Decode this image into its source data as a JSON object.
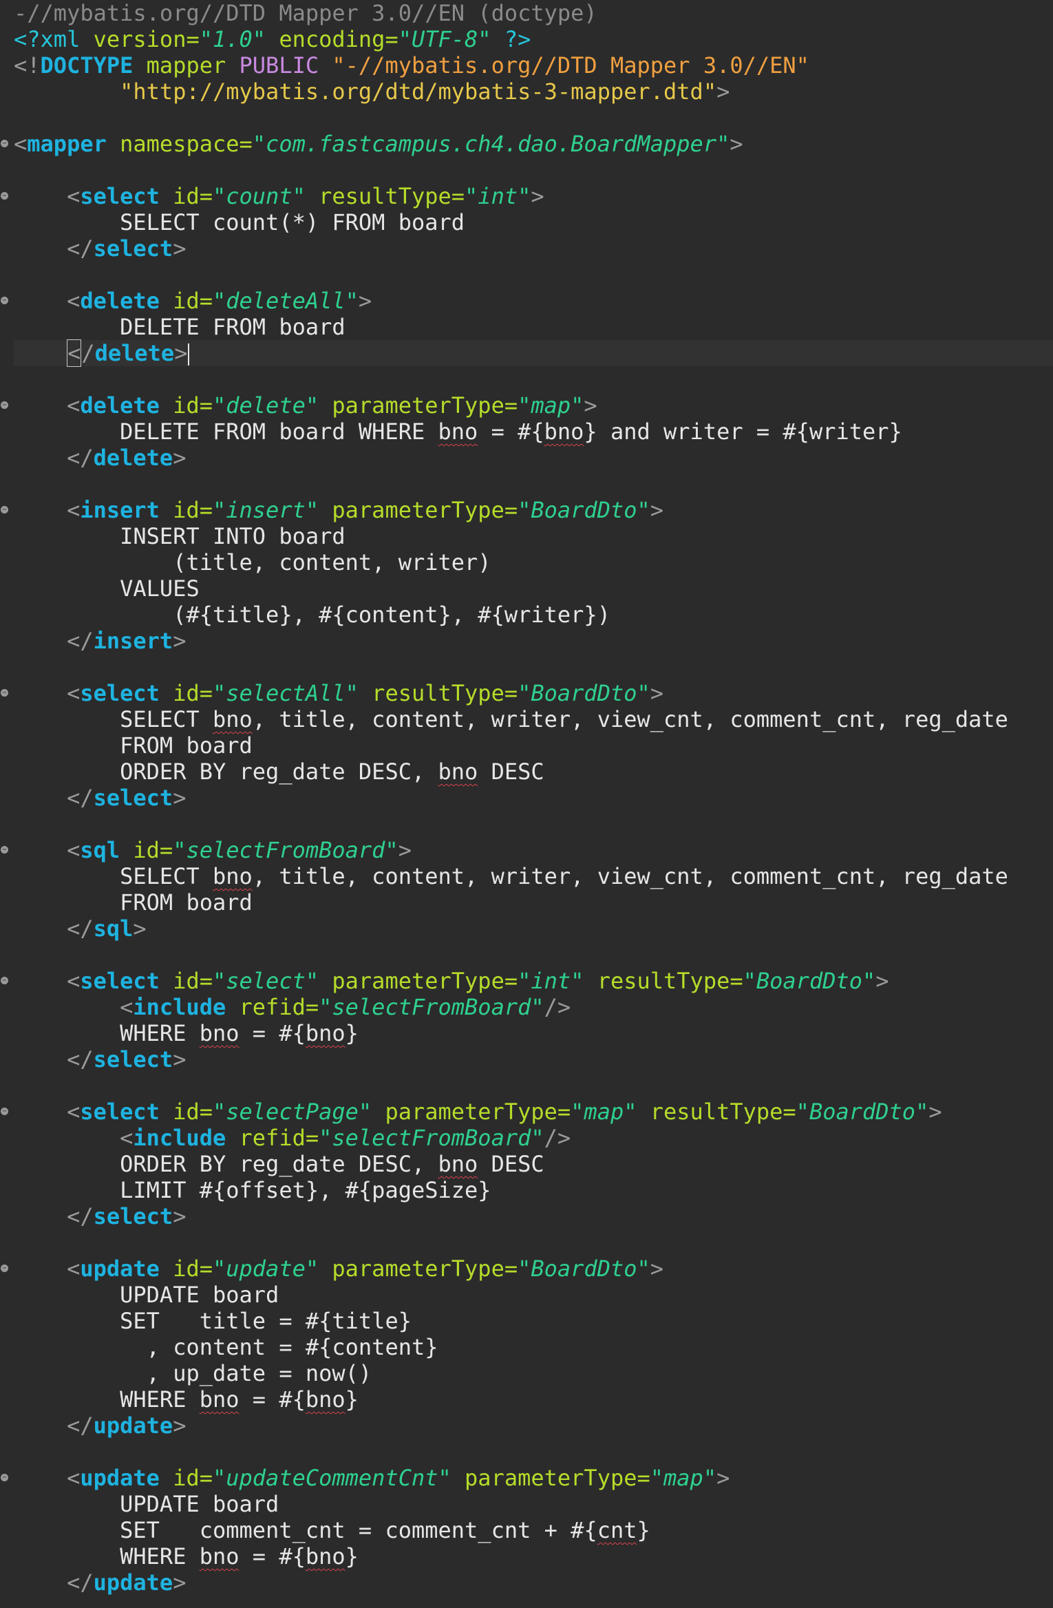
{
  "editor": {
    "lines": [
      [
        {
          "c": "c-comment",
          "t": "-//mybatis.org//DTD Mapper 3.0//EN (doctype)"
        }
      ],
      [
        {
          "c": "c-pi",
          "t": "<?xml "
        },
        {
          "c": "c-attr",
          "t": "version="
        },
        {
          "c": "c-val",
          "t": "\"1.0\""
        },
        {
          "c": "c-attr",
          "t": " encoding="
        },
        {
          "c": "c-val",
          "t": "\"UTF-8\""
        },
        {
          "c": "c-pi",
          "t": " ?>"
        }
      ],
      [
        {
          "c": "c-punct",
          "t": "<!"
        },
        {
          "c": "c-tag",
          "t": "DOCTYPE "
        },
        {
          "c": "c-attr",
          "t": "mapper "
        },
        {
          "c": "c-kw",
          "t": "PUBLIC "
        },
        {
          "c": "c-dstr",
          "t": "\"-//mybatis.org//DTD Mapper 3.0//EN\""
        }
      ],
      [
        {
          "c": "c-text",
          "t": "        "
        },
        {
          "c": "c-sstr",
          "t": "\"http://mybatis.org/dtd/mybatis-3-mapper.dtd\""
        },
        {
          "c": "c-punct",
          "t": ">"
        }
      ],
      [],
      [
        {
          "c": "c-punct",
          "t": "<"
        },
        {
          "c": "c-tag",
          "t": "mapper"
        },
        {
          "c": "c-attr",
          "t": " namespace="
        },
        {
          "c": "c-val",
          "t": "\"com.fastcampus.ch4.dao.BoardMapper\""
        },
        {
          "c": "c-punct",
          "t": ">"
        }
      ],
      [],
      [
        {
          "c": "c-text",
          "t": "    "
        },
        {
          "c": "c-punct",
          "t": "<"
        },
        {
          "c": "c-tag",
          "t": "select"
        },
        {
          "c": "c-attr",
          "t": " id="
        },
        {
          "c": "c-val",
          "t": "\"count\""
        },
        {
          "c": "c-attr",
          "t": " resultType="
        },
        {
          "c": "c-val",
          "t": "\"int\""
        },
        {
          "c": "c-punct",
          "t": ">"
        }
      ],
      [
        {
          "c": "c-text",
          "t": "        SELECT count(*) FROM board"
        }
      ],
      [
        {
          "c": "c-text",
          "t": "    "
        },
        {
          "c": "c-punct",
          "t": "</"
        },
        {
          "c": "c-tag",
          "t": "select"
        },
        {
          "c": "c-punct",
          "t": ">"
        }
      ],
      [],
      [
        {
          "c": "c-text",
          "t": "    "
        },
        {
          "c": "c-punct",
          "t": "<"
        },
        {
          "c": "c-tag",
          "t": "delete"
        },
        {
          "c": "c-attr",
          "t": " id="
        },
        {
          "c": "c-val",
          "t": "\"deleteAll\""
        },
        {
          "c": "c-punct",
          "t": ">"
        }
      ],
      [
        {
          "c": "c-text",
          "t": "        DELETE FROM board"
        }
      ],
      [
        {
          "c": "c-text",
          "t": "    "
        },
        {
          "c": "c-punct cur-box",
          "t": "<"
        },
        {
          "c": "c-punct",
          "t": "/"
        },
        {
          "c": "c-tag",
          "t": "delete"
        },
        {
          "c": "c-punct",
          "t": ">"
        }
      ],
      [],
      [
        {
          "c": "c-text",
          "t": "    "
        },
        {
          "c": "c-punct",
          "t": "<"
        },
        {
          "c": "c-tag",
          "t": "delete"
        },
        {
          "c": "c-attr",
          "t": " id="
        },
        {
          "c": "c-val",
          "t": "\"delete\""
        },
        {
          "c": "c-attr",
          "t": " parameterType="
        },
        {
          "c": "c-val",
          "t": "\"map\""
        },
        {
          "c": "c-punct",
          "t": ">"
        }
      ],
      [
        {
          "c": "c-text",
          "t": "        DELETE FROM board WHERE "
        },
        {
          "c": "c-text sq",
          "t": "bno"
        },
        {
          "c": "c-text",
          "t": " = #{"
        },
        {
          "c": "c-text sq",
          "t": "bno"
        },
        {
          "c": "c-text",
          "t": "} and writer = #{writer}"
        }
      ],
      [
        {
          "c": "c-text",
          "t": "    "
        },
        {
          "c": "c-punct",
          "t": "</"
        },
        {
          "c": "c-tag",
          "t": "delete"
        },
        {
          "c": "c-punct",
          "t": ">"
        }
      ],
      [],
      [
        {
          "c": "c-text",
          "t": "    "
        },
        {
          "c": "c-punct",
          "t": "<"
        },
        {
          "c": "c-tag",
          "t": "insert"
        },
        {
          "c": "c-attr",
          "t": " id="
        },
        {
          "c": "c-val",
          "t": "\"insert\""
        },
        {
          "c": "c-attr",
          "t": " parameterType="
        },
        {
          "c": "c-val",
          "t": "\"BoardDto\""
        },
        {
          "c": "c-punct",
          "t": ">"
        }
      ],
      [
        {
          "c": "c-text",
          "t": "        INSERT INTO board"
        }
      ],
      [
        {
          "c": "c-text",
          "t": "            (title, content, writer)"
        }
      ],
      [
        {
          "c": "c-text",
          "t": "        VALUES"
        }
      ],
      [
        {
          "c": "c-text",
          "t": "            (#{title}, #{content}, #{writer})"
        }
      ],
      [
        {
          "c": "c-text",
          "t": "    "
        },
        {
          "c": "c-punct",
          "t": "</"
        },
        {
          "c": "c-tag",
          "t": "insert"
        },
        {
          "c": "c-punct",
          "t": ">"
        }
      ],
      [],
      [
        {
          "c": "c-text",
          "t": "    "
        },
        {
          "c": "c-punct",
          "t": "<"
        },
        {
          "c": "c-tag",
          "t": "select"
        },
        {
          "c": "c-attr",
          "t": " id="
        },
        {
          "c": "c-val",
          "t": "\"selectAll\""
        },
        {
          "c": "c-attr",
          "t": " resultType="
        },
        {
          "c": "c-val",
          "t": "\"BoardDto\""
        },
        {
          "c": "c-punct",
          "t": ">"
        }
      ],
      [
        {
          "c": "c-text",
          "t": "        SELECT "
        },
        {
          "c": "c-text sq",
          "t": "bno"
        },
        {
          "c": "c-text",
          "t": ", title, content, writer, view_cnt, comment_cnt, reg_date"
        }
      ],
      [
        {
          "c": "c-text",
          "t": "        FROM board"
        }
      ],
      [
        {
          "c": "c-text",
          "t": "        ORDER BY reg_date DESC, "
        },
        {
          "c": "c-text sq",
          "t": "bno"
        },
        {
          "c": "c-text",
          "t": " DESC"
        }
      ],
      [
        {
          "c": "c-text",
          "t": "    "
        },
        {
          "c": "c-punct",
          "t": "</"
        },
        {
          "c": "c-tag",
          "t": "select"
        },
        {
          "c": "c-punct",
          "t": ">"
        }
      ],
      [],
      [
        {
          "c": "c-text",
          "t": "    "
        },
        {
          "c": "c-punct",
          "t": "<"
        },
        {
          "c": "c-tag",
          "t": "sql"
        },
        {
          "c": "c-attr",
          "t": " id="
        },
        {
          "c": "c-val",
          "t": "\"selectFromBoard\""
        },
        {
          "c": "c-punct",
          "t": ">"
        }
      ],
      [
        {
          "c": "c-text",
          "t": "        SELECT "
        },
        {
          "c": "c-text sq",
          "t": "bno"
        },
        {
          "c": "c-text",
          "t": ", title, content, writer, view_cnt, comment_cnt, reg_date"
        }
      ],
      [
        {
          "c": "c-text",
          "t": "        FROM board"
        }
      ],
      [
        {
          "c": "c-text",
          "t": "    "
        },
        {
          "c": "c-punct",
          "t": "</"
        },
        {
          "c": "c-tag",
          "t": "sql"
        },
        {
          "c": "c-punct",
          "t": ">"
        }
      ],
      [],
      [
        {
          "c": "c-text",
          "t": "    "
        },
        {
          "c": "c-punct",
          "t": "<"
        },
        {
          "c": "c-tag",
          "t": "select"
        },
        {
          "c": "c-attr",
          "t": " id="
        },
        {
          "c": "c-val",
          "t": "\"select\""
        },
        {
          "c": "c-attr",
          "t": " parameterType="
        },
        {
          "c": "c-val",
          "t": "\"int\""
        },
        {
          "c": "c-attr",
          "t": " resultType="
        },
        {
          "c": "c-val",
          "t": "\"BoardDto\""
        },
        {
          "c": "c-punct",
          "t": ">"
        }
      ],
      [
        {
          "c": "c-text",
          "t": "        "
        },
        {
          "c": "c-punct",
          "t": "<"
        },
        {
          "c": "c-tag",
          "t": "include"
        },
        {
          "c": "c-attr",
          "t": " refid="
        },
        {
          "c": "c-val",
          "t": "\"selectFromBoard\""
        },
        {
          "c": "c-punct",
          "t": "/>"
        }
      ],
      [
        {
          "c": "c-text",
          "t": "        WHERE "
        },
        {
          "c": "c-text sq",
          "t": "bno"
        },
        {
          "c": "c-text",
          "t": " = #{"
        },
        {
          "c": "c-text sq",
          "t": "bno"
        },
        {
          "c": "c-text",
          "t": "}"
        }
      ],
      [
        {
          "c": "c-text",
          "t": "    "
        },
        {
          "c": "c-punct",
          "t": "</"
        },
        {
          "c": "c-tag",
          "t": "select"
        },
        {
          "c": "c-punct",
          "t": ">"
        }
      ],
      [],
      [
        {
          "c": "c-text",
          "t": "    "
        },
        {
          "c": "c-punct",
          "t": "<"
        },
        {
          "c": "c-tag",
          "t": "select"
        },
        {
          "c": "c-attr",
          "t": " id="
        },
        {
          "c": "c-val",
          "t": "\"selectPage\""
        },
        {
          "c": "c-attr",
          "t": " parameterType="
        },
        {
          "c": "c-val",
          "t": "\"map\""
        },
        {
          "c": "c-attr",
          "t": " resultType="
        },
        {
          "c": "c-val",
          "t": "\"BoardDto\""
        },
        {
          "c": "c-punct",
          "t": ">"
        }
      ],
      [
        {
          "c": "c-text",
          "t": "        "
        },
        {
          "c": "c-punct",
          "t": "<"
        },
        {
          "c": "c-tag",
          "t": "include"
        },
        {
          "c": "c-attr",
          "t": " refid="
        },
        {
          "c": "c-val",
          "t": "\"selectFromBoard\""
        },
        {
          "c": "c-punct",
          "t": "/>"
        }
      ],
      [
        {
          "c": "c-text",
          "t": "        ORDER BY reg_date DESC, "
        },
        {
          "c": "c-text sq",
          "t": "bno"
        },
        {
          "c": "c-text",
          "t": " DESC"
        }
      ],
      [
        {
          "c": "c-text",
          "t": "        LIMIT #{offset}, #{pageSize}"
        }
      ],
      [
        {
          "c": "c-text",
          "t": "    "
        },
        {
          "c": "c-punct",
          "t": "</"
        },
        {
          "c": "c-tag",
          "t": "select"
        },
        {
          "c": "c-punct",
          "t": ">"
        }
      ],
      [],
      [
        {
          "c": "c-text",
          "t": "    "
        },
        {
          "c": "c-punct",
          "t": "<"
        },
        {
          "c": "c-tag",
          "t": "update"
        },
        {
          "c": "c-attr",
          "t": " id="
        },
        {
          "c": "c-val",
          "t": "\"update\""
        },
        {
          "c": "c-attr",
          "t": " parameterType="
        },
        {
          "c": "c-val",
          "t": "\"BoardDto\""
        },
        {
          "c": "c-punct",
          "t": ">"
        }
      ],
      [
        {
          "c": "c-text",
          "t": "        UPDATE board"
        }
      ],
      [
        {
          "c": "c-text",
          "t": "        SET   title = #{title}"
        }
      ],
      [
        {
          "c": "c-text",
          "t": "          , content = #{content}"
        }
      ],
      [
        {
          "c": "c-text",
          "t": "          , up_date = now()"
        }
      ],
      [
        {
          "c": "c-text",
          "t": "        WHERE "
        },
        {
          "c": "c-text sq",
          "t": "bno"
        },
        {
          "c": "c-text",
          "t": " = #{"
        },
        {
          "c": "c-text sq",
          "t": "bno"
        },
        {
          "c": "c-text",
          "t": "}"
        }
      ],
      [
        {
          "c": "c-text",
          "t": "    "
        },
        {
          "c": "c-punct",
          "t": "</"
        },
        {
          "c": "c-tag",
          "t": "update"
        },
        {
          "c": "c-punct",
          "t": ">"
        }
      ],
      [],
      [
        {
          "c": "c-text",
          "t": "    "
        },
        {
          "c": "c-punct",
          "t": "<"
        },
        {
          "c": "c-tag",
          "t": "update"
        },
        {
          "c": "c-attr",
          "t": " id="
        },
        {
          "c": "c-val",
          "t": "\"updateCommentCnt\""
        },
        {
          "c": "c-attr",
          "t": " parameterType="
        },
        {
          "c": "c-val",
          "t": "\"map\""
        },
        {
          "c": "c-punct",
          "t": ">"
        }
      ],
      [
        {
          "c": "c-text",
          "t": "        UPDATE board"
        }
      ],
      [
        {
          "c": "c-text",
          "t": "        SET   comment_cnt = comment_cnt + #{"
        },
        {
          "c": "c-text sq",
          "t": "cnt"
        },
        {
          "c": "c-text",
          "t": "}"
        }
      ],
      [
        {
          "c": "c-text",
          "t": "        WHERE "
        },
        {
          "c": "c-text sq",
          "t": "bno"
        },
        {
          "c": "c-text",
          "t": " = #{"
        },
        {
          "c": "c-text sq",
          "t": "bno"
        },
        {
          "c": "c-text",
          "t": "}"
        }
      ],
      [
        {
          "c": "c-text",
          "t": "    "
        },
        {
          "c": "c-punct",
          "t": "</"
        },
        {
          "c": "c-tag",
          "t": "update"
        },
        {
          "c": "c-punct",
          "t": ">"
        }
      ]
    ],
    "fold_lines": [
      5,
      7,
      11,
      15,
      19,
      26,
      32,
      37,
      42,
      48,
      56
    ],
    "current_line": 13,
    "colors": {
      "background": "#2b2b2b",
      "tag": "#1eb3e0",
      "attribute": "#b5dc2a",
      "attribute_value": "#2fd08f",
      "doctype_string": "#f0a040",
      "comment": "#8a8a8a"
    },
    "icons": {
      "fold": "fold-toggle-icon"
    }
  }
}
